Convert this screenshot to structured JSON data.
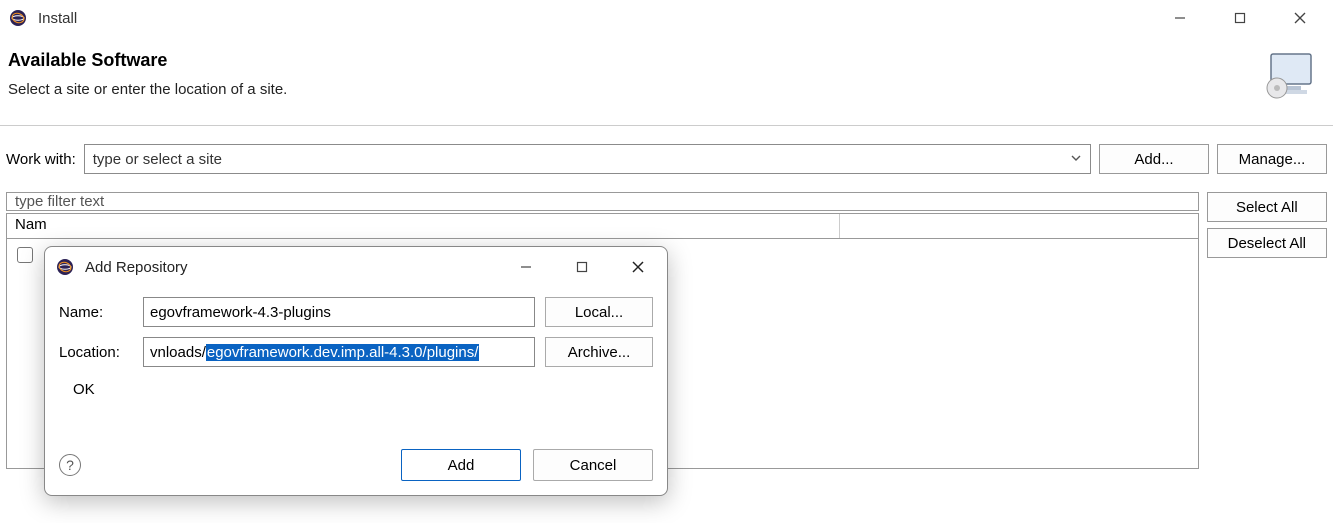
{
  "window": {
    "title": "Install"
  },
  "header": {
    "title": "Available Software",
    "subtitle": "Select a site or enter the location of a site."
  },
  "workwith": {
    "label": "Work with:",
    "placeholder": "type or select a site",
    "add_button": "Add...",
    "manage_button": "Manage..."
  },
  "filter": {
    "placeholder": "type filter text",
    "select_all": "Select All",
    "deselect_all": "Deselect All"
  },
  "list": {
    "columns": {
      "name": "Nam"
    }
  },
  "modal": {
    "title": "Add Repository",
    "name_label": "Name:",
    "name_value": "egovframework-4.3-plugins",
    "local_button": "Local...",
    "location_label": "Location:",
    "location_prefix": "vnloads/",
    "location_selected": "egovframework.dev.imp.all-4.3.0/plugins/",
    "archive_button": "Archive...",
    "status": "OK",
    "add_button": "Add",
    "cancel_button": "Cancel"
  }
}
